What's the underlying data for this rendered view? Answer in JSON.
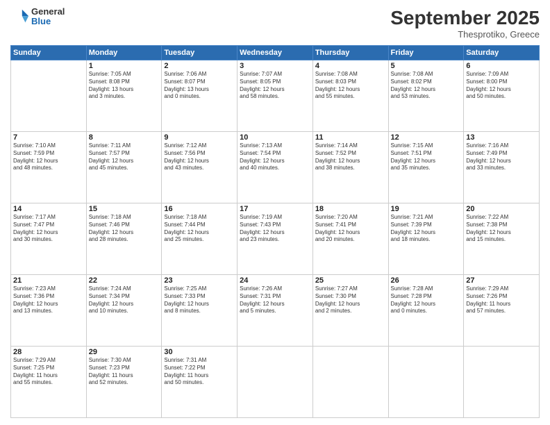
{
  "header": {
    "logo": {
      "general": "General",
      "blue": "Blue"
    },
    "title": "September 2025",
    "subtitle": "Thesprotiko, Greece"
  },
  "weekdays": [
    "Sunday",
    "Monday",
    "Tuesday",
    "Wednesday",
    "Thursday",
    "Friday",
    "Saturday"
  ],
  "weeks": [
    [
      {
        "day": "",
        "content": ""
      },
      {
        "day": "1",
        "content": "Sunrise: 7:05 AM\nSunset: 8:08 PM\nDaylight: 13 hours\nand 3 minutes."
      },
      {
        "day": "2",
        "content": "Sunrise: 7:06 AM\nSunset: 8:07 PM\nDaylight: 13 hours\nand 0 minutes."
      },
      {
        "day": "3",
        "content": "Sunrise: 7:07 AM\nSunset: 8:05 PM\nDaylight: 12 hours\nand 58 minutes."
      },
      {
        "day": "4",
        "content": "Sunrise: 7:08 AM\nSunset: 8:03 PM\nDaylight: 12 hours\nand 55 minutes."
      },
      {
        "day": "5",
        "content": "Sunrise: 7:08 AM\nSunset: 8:02 PM\nDaylight: 12 hours\nand 53 minutes."
      },
      {
        "day": "6",
        "content": "Sunrise: 7:09 AM\nSunset: 8:00 PM\nDaylight: 12 hours\nand 50 minutes."
      }
    ],
    [
      {
        "day": "7",
        "content": "Sunrise: 7:10 AM\nSunset: 7:59 PM\nDaylight: 12 hours\nand 48 minutes."
      },
      {
        "day": "8",
        "content": "Sunrise: 7:11 AM\nSunset: 7:57 PM\nDaylight: 12 hours\nand 45 minutes."
      },
      {
        "day": "9",
        "content": "Sunrise: 7:12 AM\nSunset: 7:56 PM\nDaylight: 12 hours\nand 43 minutes."
      },
      {
        "day": "10",
        "content": "Sunrise: 7:13 AM\nSunset: 7:54 PM\nDaylight: 12 hours\nand 40 minutes."
      },
      {
        "day": "11",
        "content": "Sunrise: 7:14 AM\nSunset: 7:52 PM\nDaylight: 12 hours\nand 38 minutes."
      },
      {
        "day": "12",
        "content": "Sunrise: 7:15 AM\nSunset: 7:51 PM\nDaylight: 12 hours\nand 35 minutes."
      },
      {
        "day": "13",
        "content": "Sunrise: 7:16 AM\nSunset: 7:49 PM\nDaylight: 12 hours\nand 33 minutes."
      }
    ],
    [
      {
        "day": "14",
        "content": "Sunrise: 7:17 AM\nSunset: 7:47 PM\nDaylight: 12 hours\nand 30 minutes."
      },
      {
        "day": "15",
        "content": "Sunrise: 7:18 AM\nSunset: 7:46 PM\nDaylight: 12 hours\nand 28 minutes."
      },
      {
        "day": "16",
        "content": "Sunrise: 7:18 AM\nSunset: 7:44 PM\nDaylight: 12 hours\nand 25 minutes."
      },
      {
        "day": "17",
        "content": "Sunrise: 7:19 AM\nSunset: 7:43 PM\nDaylight: 12 hours\nand 23 minutes."
      },
      {
        "day": "18",
        "content": "Sunrise: 7:20 AM\nSunset: 7:41 PM\nDaylight: 12 hours\nand 20 minutes."
      },
      {
        "day": "19",
        "content": "Sunrise: 7:21 AM\nSunset: 7:39 PM\nDaylight: 12 hours\nand 18 minutes."
      },
      {
        "day": "20",
        "content": "Sunrise: 7:22 AM\nSunset: 7:38 PM\nDaylight: 12 hours\nand 15 minutes."
      }
    ],
    [
      {
        "day": "21",
        "content": "Sunrise: 7:23 AM\nSunset: 7:36 PM\nDaylight: 12 hours\nand 13 minutes."
      },
      {
        "day": "22",
        "content": "Sunrise: 7:24 AM\nSunset: 7:34 PM\nDaylight: 12 hours\nand 10 minutes."
      },
      {
        "day": "23",
        "content": "Sunrise: 7:25 AM\nSunset: 7:33 PM\nDaylight: 12 hours\nand 8 minutes."
      },
      {
        "day": "24",
        "content": "Sunrise: 7:26 AM\nSunset: 7:31 PM\nDaylight: 12 hours\nand 5 minutes."
      },
      {
        "day": "25",
        "content": "Sunrise: 7:27 AM\nSunset: 7:30 PM\nDaylight: 12 hours\nand 2 minutes."
      },
      {
        "day": "26",
        "content": "Sunrise: 7:28 AM\nSunset: 7:28 PM\nDaylight: 12 hours\nand 0 minutes."
      },
      {
        "day": "27",
        "content": "Sunrise: 7:29 AM\nSunset: 7:26 PM\nDaylight: 11 hours\nand 57 minutes."
      }
    ],
    [
      {
        "day": "28",
        "content": "Sunrise: 7:29 AM\nSunset: 7:25 PM\nDaylight: 11 hours\nand 55 minutes."
      },
      {
        "day": "29",
        "content": "Sunrise: 7:30 AM\nSunset: 7:23 PM\nDaylight: 11 hours\nand 52 minutes."
      },
      {
        "day": "30",
        "content": "Sunrise: 7:31 AM\nSunset: 7:22 PM\nDaylight: 11 hours\nand 50 minutes."
      },
      {
        "day": "",
        "content": ""
      },
      {
        "day": "",
        "content": ""
      },
      {
        "day": "",
        "content": ""
      },
      {
        "day": "",
        "content": ""
      }
    ]
  ]
}
